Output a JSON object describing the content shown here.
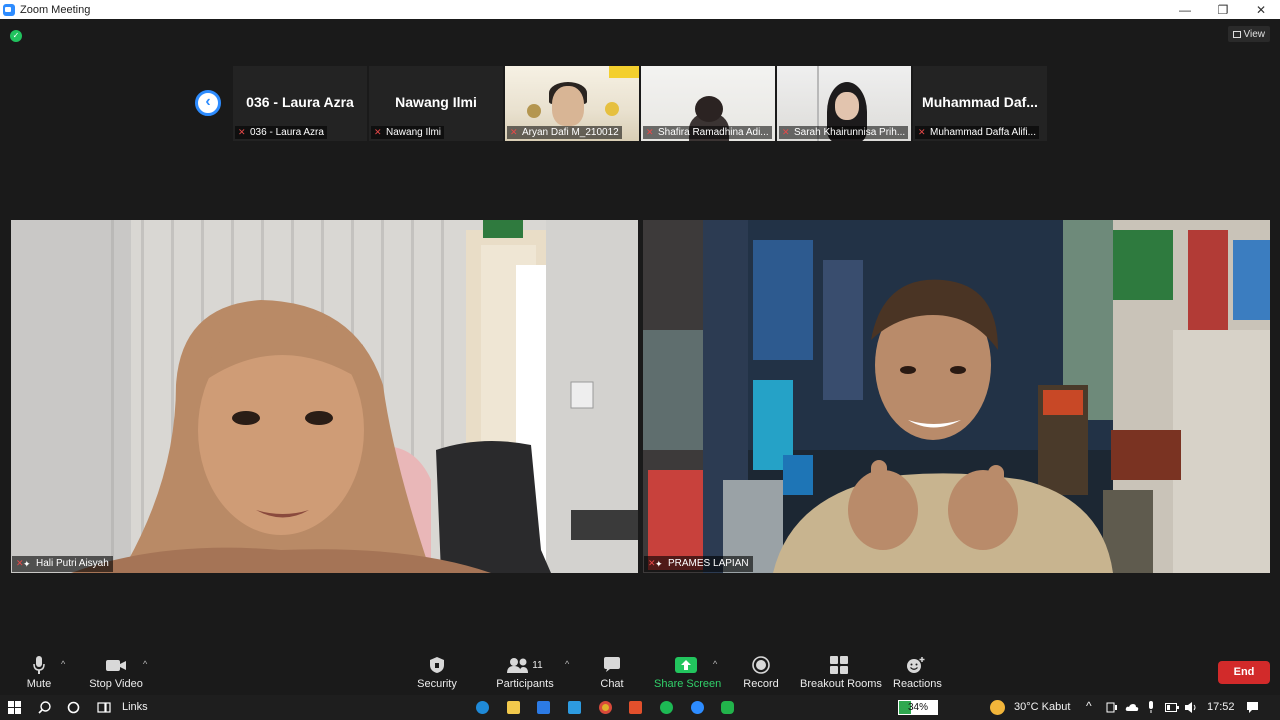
{
  "window": {
    "title": "Zoom Meeting",
    "minimize": "—",
    "maximize": "❐",
    "close": "✕"
  },
  "top": {
    "view_label": "View"
  },
  "strip": {
    "tiles": [
      {
        "big_name": "036 - Laura Azra",
        "label": "036 - Laura Azra"
      },
      {
        "big_name": "Nawang Ilmi",
        "label": "Nawang Ilmi"
      },
      {
        "label": "Aryan Dafi M_210012"
      },
      {
        "label": "Shafira Ramadhina Adi..."
      },
      {
        "label": "Sarah Khairunnisa Prih..."
      },
      {
        "big_name": "Muhammad  Daf...",
        "label": "Muhammad Daffa Alifi..."
      }
    ]
  },
  "main": {
    "left_name": "Hali Putri Aisyah",
    "right_name": "PRAMES LAPIAN"
  },
  "toolbar": {
    "mute": "Mute",
    "stop_video": "Stop Video",
    "security": "Security",
    "participants": "Participants",
    "participants_count": "11",
    "chat": "Chat",
    "share_screen": "Share Screen",
    "record": "Record",
    "breakout_rooms": "Breakout Rooms",
    "reactions": "Reactions",
    "end": "End"
  },
  "taskbar": {
    "links": "Links",
    "battery": "34%",
    "weather": "30°C  Kabut",
    "time": "17:52"
  },
  "colors": {
    "accent_blue": "#2d8cff",
    "share_green": "#22c55e",
    "end_red": "#d22a2a",
    "background": "#1a1a1a"
  }
}
